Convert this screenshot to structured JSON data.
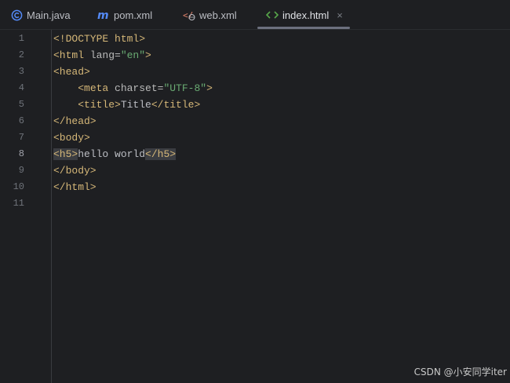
{
  "tabs": [
    {
      "label": "Main.java",
      "icon": "java-class-icon"
    },
    {
      "label": "pom.xml",
      "icon": "maven-icon"
    },
    {
      "label": "web.xml",
      "icon": "web-xml-icon"
    },
    {
      "label": "index.html",
      "icon": "html-icon",
      "active": true,
      "close": "×"
    }
  ],
  "line_numbers": [
    "1",
    "2",
    "3",
    "4",
    "5",
    "6",
    "7",
    "8",
    "9",
    "10",
    "11"
  ],
  "code": {
    "l1": {
      "a": "<!DOCTYPE html>"
    },
    "l2": {
      "a": "<html ",
      "b": "lang=",
      "c": "\"en\"",
      "d": ">"
    },
    "l3": {
      "a": "<head>"
    },
    "l4": {
      "indent": "    ",
      "a": "<meta ",
      "b": "charset=",
      "c": "\"UTF-8\"",
      "d": ">"
    },
    "l5": {
      "indent": "    ",
      "a": "<title>",
      "b": "Title",
      "c": "</title>"
    },
    "l6": {
      "a": "</head>"
    },
    "l7": {
      "a": "<body>"
    },
    "l8": {
      "a": "<h5>",
      "b": "hello world",
      "c": "</h5>"
    },
    "l9": {
      "a": "</body>"
    },
    "l10": {
      "a": "</html>"
    }
  },
  "current_line": 8,
  "watermark": "CSDN @小安同学iter",
  "colors": {
    "background": "#1e1f22",
    "tag": "#d5b778",
    "string": "#6aab73",
    "text": "#bcbec4",
    "line_number": "#6f737a"
  }
}
